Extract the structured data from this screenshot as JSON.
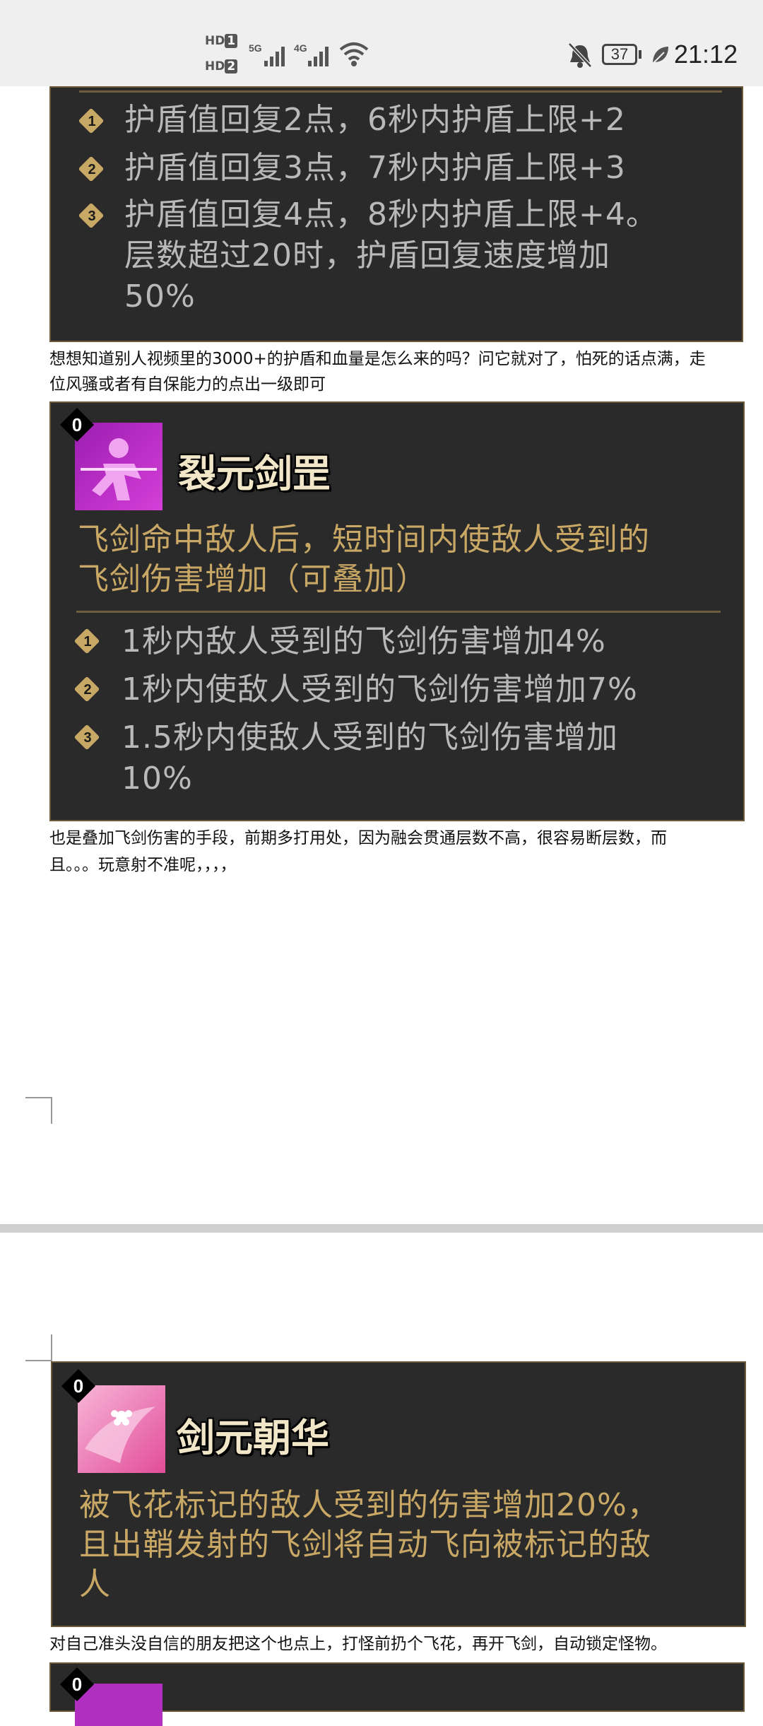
{
  "status_bar": {
    "hd1": "HD",
    "hd1_num": "1",
    "hd2": "HD",
    "hd2_num": "2",
    "net1": "5G",
    "net2": "4G",
    "battery": "37",
    "time": "21:12"
  },
  "card1": {
    "items": [
      {
        "num": "1",
        "text": "护盾值回复2点，6秒内护盾上限+2"
      },
      {
        "num": "2",
        "text": "护盾值回复3点，7秒内护盾上限+3"
      },
      {
        "num": "3",
        "lines": [
          "护盾值回复4点，8秒内护盾上限+4。",
          "层数超过20时，护盾回复速度增加",
          "50%"
        ]
      }
    ]
  },
  "para1": {
    "line1": "想想知道别人视频里的3000+的护盾和血量是怎么来的吗？问它就对了，怕死的话点满，走",
    "line2": "位风骚或者有自保能力的点出一级即可"
  },
  "card2": {
    "badge": "0",
    "title": "裂元剑罡",
    "desc_lines": [
      "飞剑命中敌人后，短时间内使敌人受到的",
      "飞剑伤害增加（可叠加）"
    ],
    "items": [
      {
        "num": "1",
        "text": "1秒内敌人受到的飞剑伤害增加4%"
      },
      {
        "num": "2",
        "text": "1秒内使敌人受到的飞剑伤害增加7%"
      },
      {
        "num": "3",
        "lines": [
          "1.5秒内使敌人受到的飞剑伤害增加",
          "10%"
        ]
      }
    ]
  },
  "para2": {
    "line1": "也是叠加飞剑伤害的手段，前期多打用处，因为融会贯通层数不高，很容易断层数，而",
    "line2": "且。。。玩意射不准呢，，，，"
  },
  "card3": {
    "badge": "0",
    "title": "剑元朝华",
    "desc_lines": [
      "被飞花标记的敌人受到的伤害增加20%，",
      "且出鞘发射的飞剑将自动飞向被标记的敌",
      "人"
    ]
  },
  "para3": {
    "line1": "对自己准头没自信的朋友把这个也点上，打怪前扔个飞花，再开飞剑，自动锁定怪物。"
  },
  "card4": {
    "badge": "0"
  }
}
